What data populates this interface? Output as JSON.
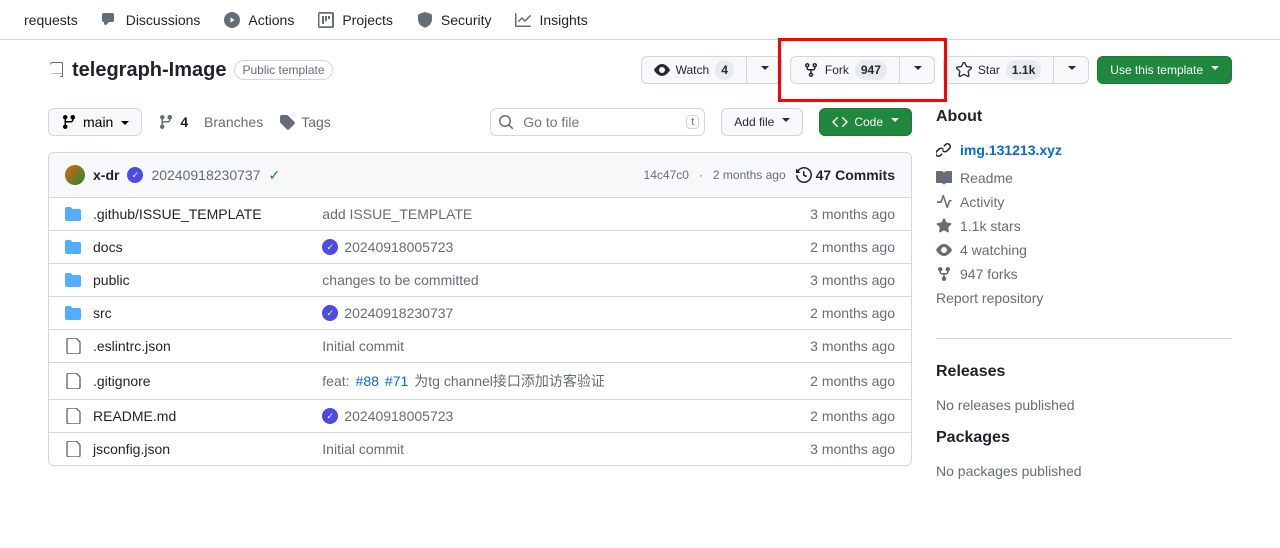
{
  "topnav": [
    "requests",
    "Discussions",
    "Actions",
    "Projects",
    "Security",
    "Insights"
  ],
  "repo": {
    "name": "telegraph-Image",
    "badge": "Public template"
  },
  "actions": {
    "watch": {
      "label": "Watch",
      "count": "4"
    },
    "fork": {
      "label": "Fork",
      "count": "947"
    },
    "star": {
      "label": "Star",
      "count": "1.1k"
    },
    "template": "Use this template"
  },
  "branch": {
    "name": "main",
    "branches_count": "4",
    "branches_label": "Branches",
    "tags_label": "Tags"
  },
  "search": {
    "placeholder": "Go to file",
    "kbd": "t"
  },
  "filebar": {
    "addfile": "Add file",
    "code": "Code"
  },
  "commit": {
    "author": "x-dr",
    "msg": "20240918230737",
    "sha": "14c47c0",
    "date": "2 months ago",
    "commits": "47 Commits"
  },
  "files": [
    {
      "t": "d",
      "n": ".github/ISSUE_TEMPLATE",
      "m": "add ISSUE_TEMPLATE",
      "d": "3 months ago",
      "v": false
    },
    {
      "t": "d",
      "n": "docs",
      "m": "20240918005723",
      "d": "2 months ago",
      "v": true
    },
    {
      "t": "d",
      "n": "public",
      "m": "changes to be committed",
      "d": "3 months ago",
      "v": false
    },
    {
      "t": "d",
      "n": "src",
      "m": "20240918230737",
      "d": "2 months ago",
      "v": true
    },
    {
      "t": "f",
      "n": ".eslintrc.json",
      "m": "Initial commit",
      "d": "3 months ago",
      "v": false
    },
    {
      "t": "f",
      "n": ".gitignore",
      "m": "为tg channel接口添加访客验证",
      "d": "2 months ago",
      "v": false,
      "links": [
        "#88",
        "#71"
      ],
      "prefix": "feat: "
    },
    {
      "t": "f",
      "n": "README.md",
      "m": "20240918005723",
      "d": "2 months ago",
      "v": true
    },
    {
      "t": "f",
      "n": "jsconfig.json",
      "m": "Initial commit",
      "d": "3 months ago",
      "v": false
    }
  ],
  "about": {
    "title": "About",
    "url": "img.131213.xyz",
    "items": [
      "Readme",
      "Activity",
      "1.1k stars",
      "4 watching",
      "947 forks"
    ],
    "report": "Report repository"
  },
  "releases": {
    "title": "Releases",
    "text": "No releases published"
  },
  "packages": {
    "title": "Packages",
    "text": "No packages published"
  }
}
